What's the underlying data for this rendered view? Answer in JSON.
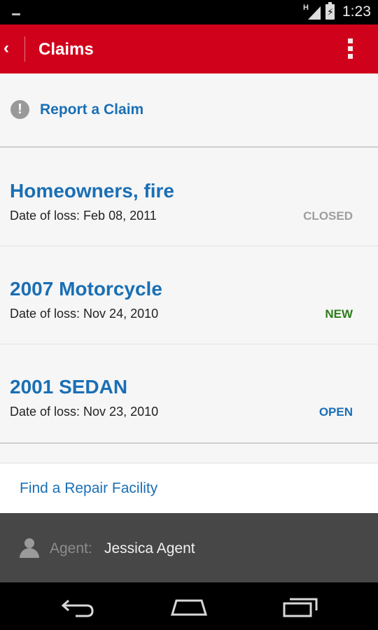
{
  "status_bar": {
    "network_label": "H",
    "battery_glyph": "⚡",
    "time": "1:23"
  },
  "app_bar": {
    "back_glyph": "‹",
    "title": "Claims"
  },
  "report": {
    "icon_glyph": "!",
    "label": "Report a Claim"
  },
  "claims": [
    {
      "title": "Homeowners, fire",
      "date": "Date of loss: Feb 08, 2011",
      "status": "CLOSED",
      "status_color": "#9e9e9e"
    },
    {
      "title": "2007 Motorcycle",
      "date": "Date of loss: Nov 24, 2010",
      "status": "NEW",
      "status_color": "#2e7d1a"
    },
    {
      "title": "2001 SEDAN",
      "date": "Date of loss: Nov 23, 2010",
      "status": "OPEN",
      "status_color": "#1a6fb5"
    }
  ],
  "repair": {
    "label": "Find a Repair Facility"
  },
  "agent": {
    "label": "Agent:",
    "name": "Jessica Agent"
  },
  "nav": {
    "icons": [
      "back-icon",
      "home-icon",
      "recent-apps-icon"
    ]
  },
  "colors": {
    "accent": "#d0021b",
    "link": "#1a6fb5"
  }
}
